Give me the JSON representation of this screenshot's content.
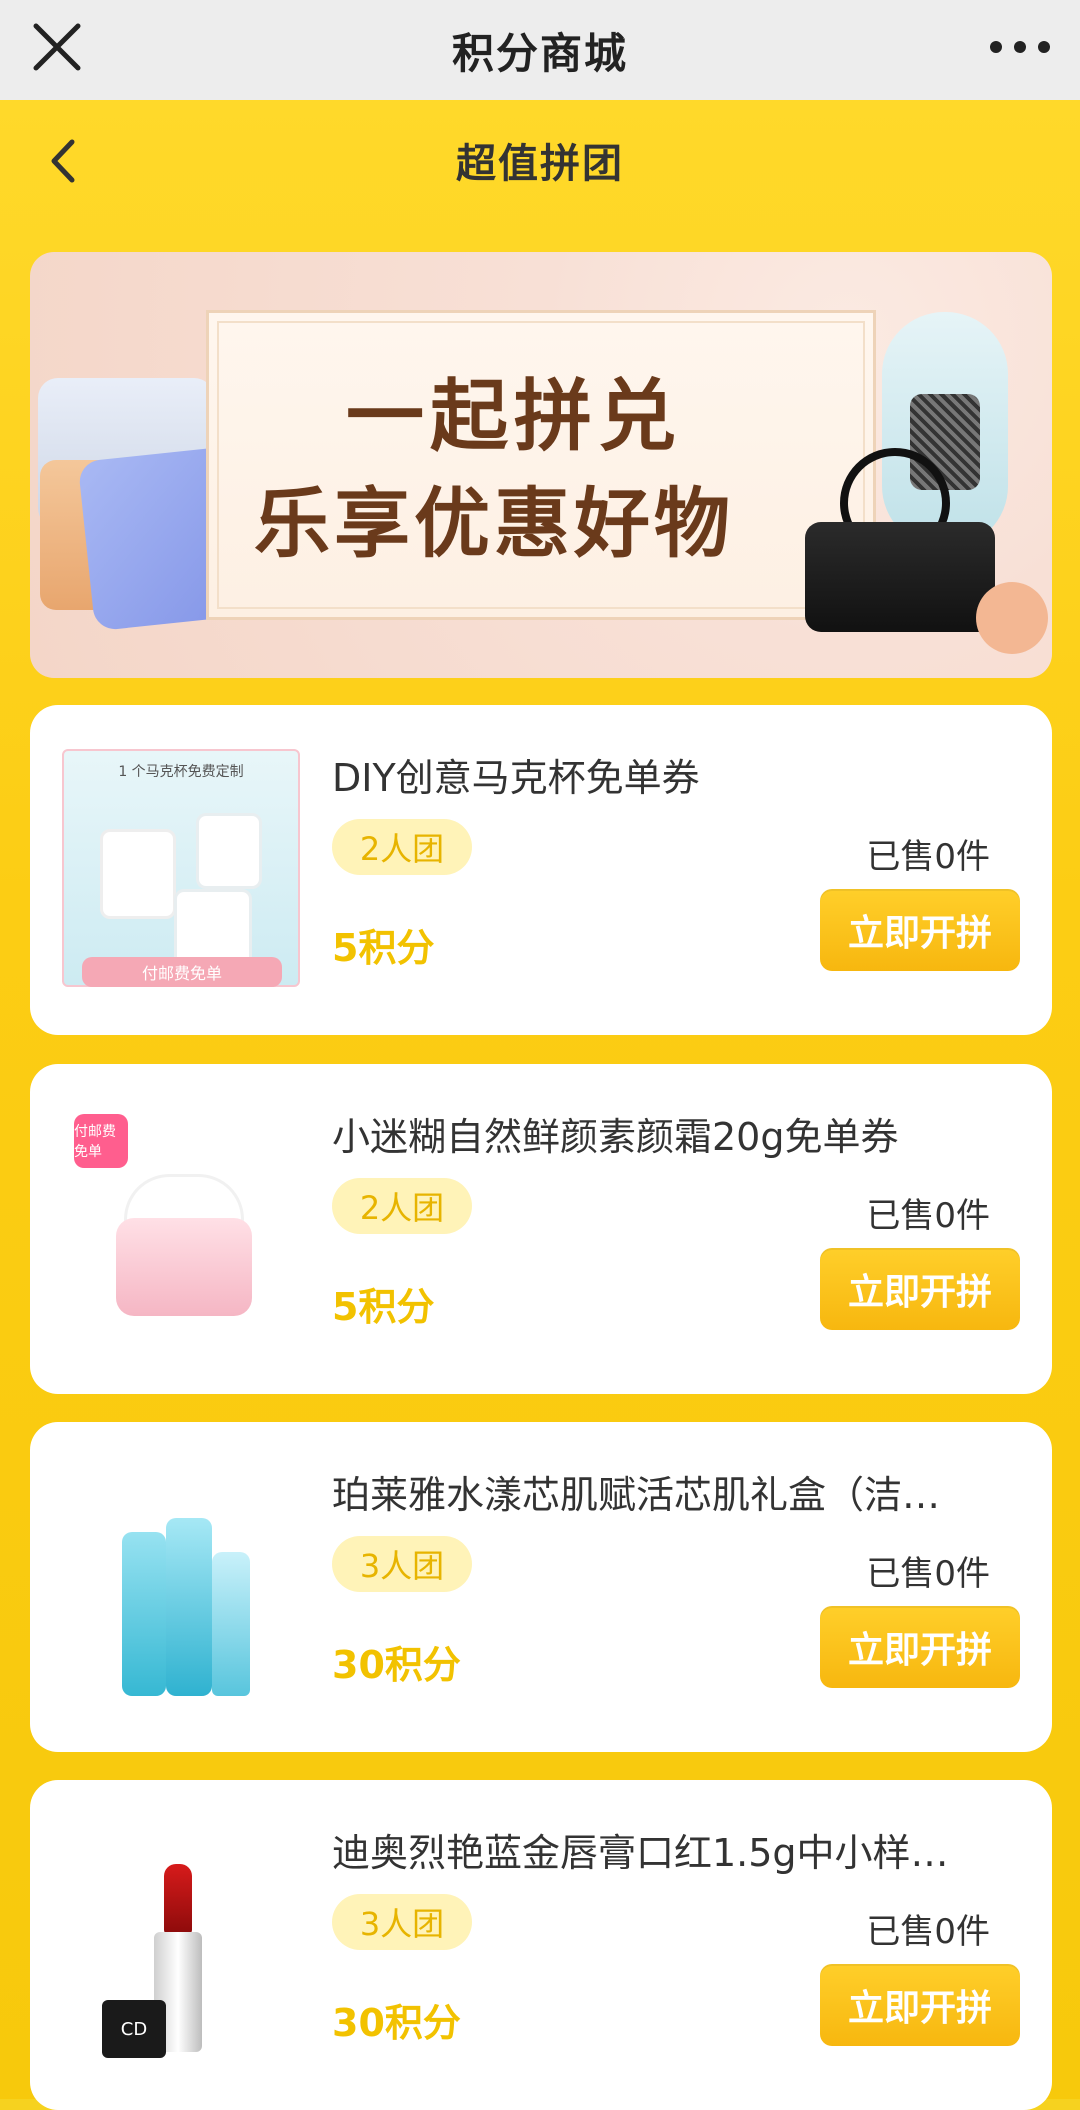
{
  "top_bar": {
    "title": "积分商城"
  },
  "nav": {
    "title": "超值拼团"
  },
  "banner": {
    "line1": "一起拼兑",
    "line2": "乐享优惠好物"
  },
  "products": [
    {
      "name": "DIY创意马克杯免单券",
      "group": "2人团",
      "sold": "已售0件",
      "price": "5积分",
      "button": "立即开拼",
      "image_caption": "1 个马克杯免费定制",
      "image_ribbon": "付邮费免单"
    },
    {
      "name": "小迷糊自然鲜颜素颜霜20g免单券",
      "group": "2人团",
      "sold": "已售0件",
      "price": "5积分",
      "button": "立即开拼",
      "image_stamp": "付邮费免单"
    },
    {
      "name": "珀莱雅水漾芯肌赋活芯肌礼盒（洁…",
      "group": "3人团",
      "sold": "已售0件",
      "price": "30积分",
      "button": "立即开拼"
    },
    {
      "name": "迪奥烈艳蓝金唇膏口红1.5g中小样…",
      "group": "3人团",
      "sold": "已售0件",
      "price": "30积分",
      "button": "立即开拼",
      "image_logo": "CD"
    }
  ]
}
